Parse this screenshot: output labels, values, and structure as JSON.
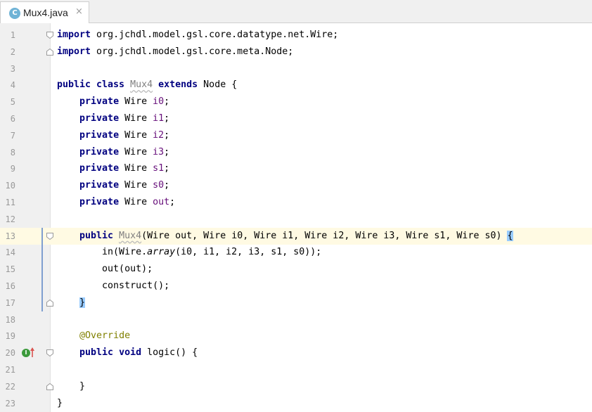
{
  "tab": {
    "icon_letter": "C",
    "title": "Mux4.java",
    "close_symbol": "×"
  },
  "lines": [
    {
      "num": "1",
      "segments": [
        {
          "t": "kw",
          "v": "import"
        },
        {
          "t": "plain",
          "v": " org.jchdl.model.gsl.core.datatype.net.Wire;"
        }
      ]
    },
    {
      "num": "2",
      "segments": [
        {
          "t": "kw",
          "v": "import"
        },
        {
          "t": "plain",
          "v": " org.jchdl.model.gsl.core.meta.Node;"
        }
      ]
    },
    {
      "num": "3",
      "segments": []
    },
    {
      "num": "4",
      "segments": [
        {
          "t": "kw",
          "v": "public class "
        },
        {
          "t": "unused",
          "v": "Mux4"
        },
        {
          "t": "plain",
          "v": " "
        },
        {
          "t": "kw",
          "v": "extends"
        },
        {
          "t": "plain",
          "v": " Node {"
        }
      ]
    },
    {
      "num": "5",
      "segments": [
        {
          "t": "plain",
          "v": "    "
        },
        {
          "t": "kw",
          "v": "private"
        },
        {
          "t": "plain",
          "v": " Wire "
        },
        {
          "t": "fld",
          "v": "i0"
        },
        {
          "t": "plain",
          "v": ";"
        }
      ]
    },
    {
      "num": "6",
      "segments": [
        {
          "t": "plain",
          "v": "    "
        },
        {
          "t": "kw",
          "v": "private"
        },
        {
          "t": "plain",
          "v": " Wire "
        },
        {
          "t": "fld",
          "v": "i1"
        },
        {
          "t": "plain",
          "v": ";"
        }
      ]
    },
    {
      "num": "7",
      "segments": [
        {
          "t": "plain",
          "v": "    "
        },
        {
          "t": "kw",
          "v": "private"
        },
        {
          "t": "plain",
          "v": " Wire "
        },
        {
          "t": "fld",
          "v": "i2"
        },
        {
          "t": "plain",
          "v": ";"
        }
      ]
    },
    {
      "num": "8",
      "segments": [
        {
          "t": "plain",
          "v": "    "
        },
        {
          "t": "kw",
          "v": "private"
        },
        {
          "t": "plain",
          "v": " Wire "
        },
        {
          "t": "fld",
          "v": "i3"
        },
        {
          "t": "plain",
          "v": ";"
        }
      ]
    },
    {
      "num": "9",
      "segments": [
        {
          "t": "plain",
          "v": "    "
        },
        {
          "t": "kw",
          "v": "private"
        },
        {
          "t": "plain",
          "v": " Wire "
        },
        {
          "t": "fld",
          "v": "s1"
        },
        {
          "t": "plain",
          "v": ";"
        }
      ]
    },
    {
      "num": "10",
      "segments": [
        {
          "t": "plain",
          "v": "    "
        },
        {
          "t": "kw",
          "v": "private"
        },
        {
          "t": "plain",
          "v": " Wire "
        },
        {
          "t": "fld",
          "v": "s0"
        },
        {
          "t": "plain",
          "v": ";"
        }
      ]
    },
    {
      "num": "11",
      "segments": [
        {
          "t": "plain",
          "v": "    "
        },
        {
          "t": "kw",
          "v": "private"
        },
        {
          "t": "plain",
          "v": " Wire "
        },
        {
          "t": "fld",
          "v": "out"
        },
        {
          "t": "plain",
          "v": ";"
        }
      ]
    },
    {
      "num": "12",
      "segments": []
    },
    {
      "num": "13",
      "segments": [
        {
          "t": "plain",
          "v": "    "
        },
        {
          "t": "kw",
          "v": "public"
        },
        {
          "t": "plain",
          "v": " "
        },
        {
          "t": "unused",
          "v": "Mux4"
        },
        {
          "t": "plain",
          "v": "(Wire out, Wire i0, Wire i1, Wire i2, Wire i3, Wire s1, Wire s0) "
        },
        {
          "t": "brace",
          "v": "{"
        }
      ]
    },
    {
      "num": "14",
      "segments": [
        {
          "t": "plain",
          "v": "        in(Wire."
        },
        {
          "t": "ital",
          "v": "array"
        },
        {
          "t": "plain",
          "v": "(i0, i1, i2, i3, s1, s0));"
        }
      ]
    },
    {
      "num": "15",
      "segments": [
        {
          "t": "plain",
          "v": "        out(out);"
        }
      ]
    },
    {
      "num": "16",
      "segments": [
        {
          "t": "plain",
          "v": "        construct();"
        }
      ]
    },
    {
      "num": "17",
      "segments": [
        {
          "t": "plain",
          "v": "    "
        },
        {
          "t": "brace",
          "v": "}"
        }
      ]
    },
    {
      "num": "18",
      "segments": []
    },
    {
      "num": "19",
      "segments": [
        {
          "t": "plain",
          "v": "    "
        },
        {
          "t": "ann",
          "v": "@Override"
        }
      ]
    },
    {
      "num": "20",
      "segments": [
        {
          "t": "plain",
          "v": "    "
        },
        {
          "t": "kw",
          "v": "public void"
        },
        {
          "t": "plain",
          "v": " logic() {"
        }
      ]
    },
    {
      "num": "21",
      "segments": []
    },
    {
      "num": "22",
      "segments": [
        {
          "t": "plain",
          "v": "    }"
        }
      ]
    },
    {
      "num": "23",
      "segments": [
        {
          "t": "plain",
          "v": "}"
        }
      ]
    }
  ],
  "current_line": "13",
  "fold_markers": [
    {
      "line": "1",
      "kind": "start"
    },
    {
      "line": "2",
      "kind": "end"
    },
    {
      "line": "13",
      "kind": "start"
    },
    {
      "line": "17",
      "kind": "end"
    },
    {
      "line": "20",
      "kind": "start"
    },
    {
      "line": "22",
      "kind": "end"
    }
  ],
  "implements_marker": {
    "line": "20",
    "icon": "implements-method-icon",
    "letter": "I"
  },
  "colors": {
    "keyword": "#000080",
    "field": "#660e7a",
    "annotation": "#808000",
    "current_line_bg": "#fffae3",
    "brace_match": "#99ccff"
  }
}
